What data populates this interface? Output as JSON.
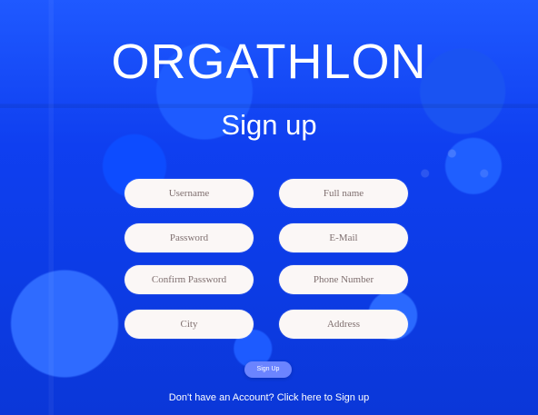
{
  "header": {
    "brand": "ORGATHLON",
    "title": "Sign up"
  },
  "form": {
    "fields": [
      {
        "placeholder": "Username"
      },
      {
        "placeholder": "Full name"
      },
      {
        "placeholder": "Password"
      },
      {
        "placeholder": "E-Mail"
      },
      {
        "placeholder": "Confirm Password"
      },
      {
        "placeholder": "Phone Number"
      },
      {
        "placeholder": "City"
      },
      {
        "placeholder": "Address"
      }
    ],
    "submit_label": "Sign Up"
  },
  "footer": {
    "link_text": "Don't have an Account? Click here to Sign up"
  }
}
